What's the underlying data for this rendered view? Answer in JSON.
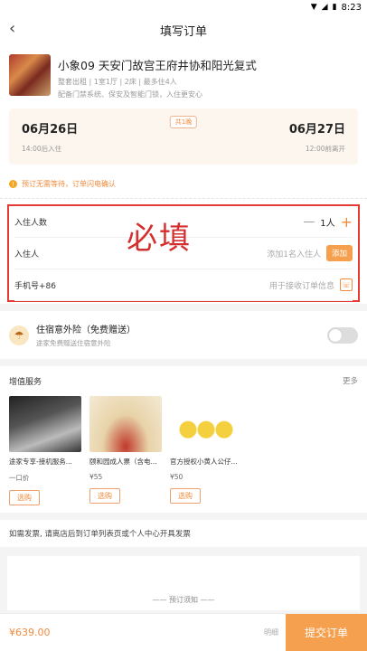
{
  "status": {
    "time": "8:23"
  },
  "header": {
    "title": "填写订单"
  },
  "hotel": {
    "name": "小象09 天安门故宫王府井协和阳光复式",
    "meta": "整套出租 | 1室1厅 | 2床 | 最多住4人",
    "desc": "配备门禁系统、保安及智能门锁，入住更安心"
  },
  "stay": {
    "checkin_date": "06月26日",
    "checkin_sub": "14:00后入住",
    "nights": "共1晚",
    "checkout_date": "06月27日",
    "checkout_sub": "12:00前离开"
  },
  "notice": "预订无需等待，订单闪电确认",
  "form": {
    "guests_label": "入住人数",
    "guests_value": "1人",
    "guest_label": "入住人",
    "guest_placeholder": "添加1名入住人",
    "add_label": "添加",
    "phone_label": "手机号+86",
    "phone_placeholder": "用于接收订单信息",
    "annotation": "必填"
  },
  "insurance": {
    "title": "住宿意外险（免费赠送）",
    "sub": "途家免费赠送住宿意外险"
  },
  "services": {
    "title": "增值服务",
    "more": "更多",
    "items": [
      {
        "name": "途家专享-接机服务...",
        "price": "一口价",
        "btn": "选购"
      },
      {
        "name": "颐和园成人票（含电...",
        "price": "¥55",
        "btn": "选购"
      },
      {
        "name": "官方授权小黄人公仔...",
        "price": "¥50",
        "btn": "选购"
      }
    ]
  },
  "invoice": "如需发票, 请离店后到订单列表页或个人中心开具发票",
  "booking_notice": "—— 预订须知 ——",
  "bottom": {
    "price": "¥639.00",
    "detail": "明细",
    "submit": "提交订单"
  }
}
